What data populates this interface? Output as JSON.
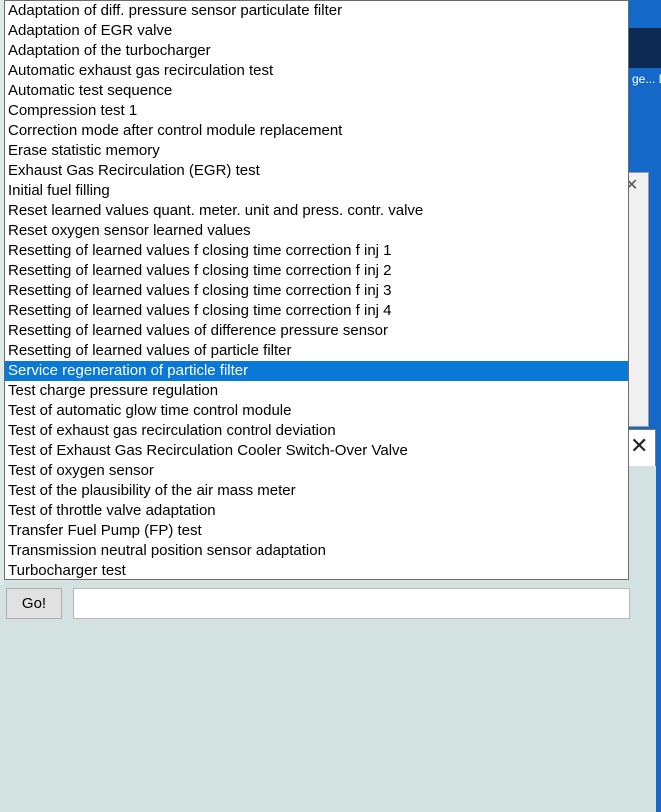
{
  "dropdown": {
    "items": [
      "Adaptation of diff. pressure sensor particulate filter",
      "Adaptation of EGR valve",
      "Adaptation of the turbocharger",
      "Automatic exhaust gas recirculation test",
      "Automatic test sequence",
      "Compression test 1",
      "Correction mode after control module replacement",
      "Erase statistic memory",
      "Exhaust Gas Recirculation (EGR) test",
      "Initial fuel filling",
      "Reset learned values quant. meter. unit and press. contr. valve",
      "Reset oxygen sensor learned values",
      "Resetting of learned values f closing time correction f inj 1",
      "Resetting of learned values f closing time correction f inj 2",
      "Resetting of learned values f closing time correction f inj 3",
      "Resetting of learned values f closing time correction f inj 4",
      "Resetting of learned values of difference pressure sensor",
      "Resetting of learned values of particle filter",
      "Service regeneration of particle filter",
      "Test charge pressure regulation",
      "Test of automatic glow time control module",
      "Test of exhaust gas recirculation control deviation",
      "Test of Exhaust Gas Recirculation Cooler Switch-Over Valve",
      "Test of oxygen sensor",
      "Test of the plausibility of the air mass meter",
      "Test of throttle valve adaptation",
      "Transfer Fuel Pump (FP) test",
      "Transmission neutral position sensor adaptation",
      "Turbocharger test"
    ],
    "selected_index": 18
  },
  "controls": {
    "go_label": "Go!",
    "input_value": ""
  },
  "desktop": {
    "label": "ge... D"
  },
  "icons": {
    "close": "close-icon"
  },
  "colors": {
    "selection": "#0a78d7",
    "background": "#d3e1e0",
    "desktop": "#1468c8"
  }
}
